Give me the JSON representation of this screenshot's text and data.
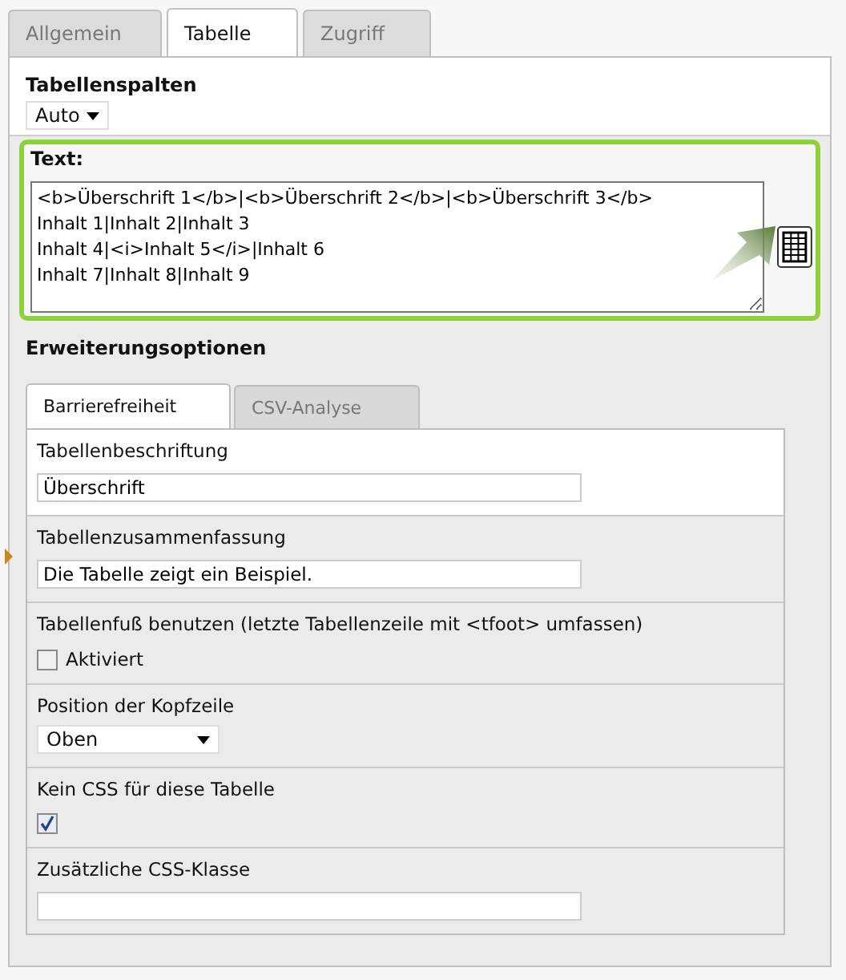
{
  "tabs": [
    {
      "label": "Allgemein",
      "selected": false
    },
    {
      "label": "Tabelle",
      "selected": true
    },
    {
      "label": "Zugriff",
      "selected": false
    }
  ],
  "columns": {
    "label": "Tabellenspalten",
    "value": "Auto"
  },
  "text": {
    "label": "Text:",
    "lines": [
      "<b>Überschrift 1</b>|<b>Überschrift 2</b>|<b>Überschrift 3</b>",
      "Inhalt 1|Inhalt 2|Inhalt 3",
      "Inhalt 4|<i>Inhalt 5</i>|Inhalt 6",
      "Inhalt 7|Inhalt 8|Inhalt 9"
    ]
  },
  "extensions": {
    "title": "Erweiterungsoptionen",
    "tabs": [
      {
        "label": "Barrierefreiheit",
        "selected": true
      },
      {
        "label": "CSV-Analyse",
        "selected": false
      }
    ],
    "fields": [
      {
        "kind": "text",
        "label": "Tabellenbeschriftung",
        "value": "Überschrift",
        "marked": false
      },
      {
        "kind": "text",
        "label": "Tabellenzusammenfassung",
        "value": "Die Tabelle zeigt ein Beispiel.",
        "marked": true
      },
      {
        "kind": "checkbox",
        "label": "Tabellenfuß benutzen (letzte Tabellenzeile mit <tfoot> umfassen)",
        "option": "Aktiviert",
        "checked": false,
        "marked": false
      },
      {
        "kind": "select",
        "label": "Position der Kopfzeile",
        "value": "Oben",
        "marked": false
      },
      {
        "kind": "checkbox",
        "label": "Kein CSS für diese Tabelle",
        "checked": true,
        "marked": false
      },
      {
        "kind": "text",
        "label": "Zusätzliche CSS-Klasse",
        "marked": false
      }
    ]
  }
}
